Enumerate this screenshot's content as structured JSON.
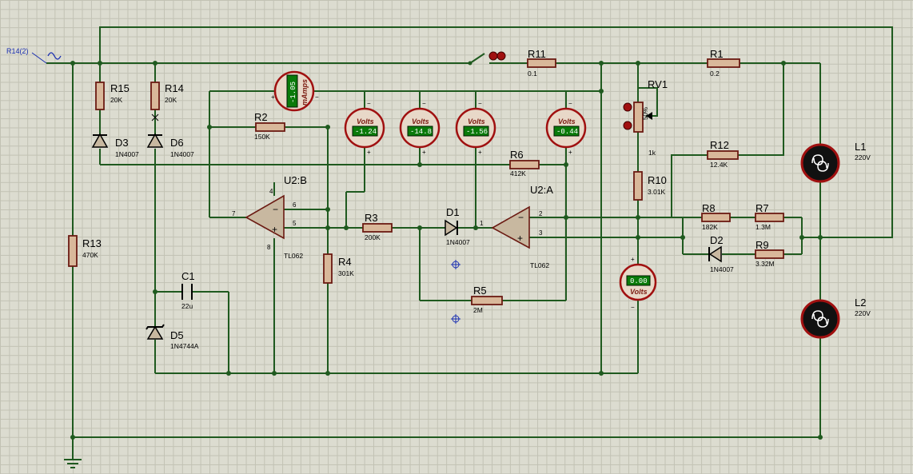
{
  "source_label": "R14(2)",
  "components": {
    "R15": {
      "name": "R15",
      "value": "20K"
    },
    "R14": {
      "name": "R14",
      "value": "20K"
    },
    "D3": {
      "name": "D3",
      "value": "1N4007"
    },
    "D6": {
      "name": "D6",
      "value": "1N4007"
    },
    "R13": {
      "name": "R13",
      "value": "470K"
    },
    "C1": {
      "name": "C1",
      "value": "22u"
    },
    "D5": {
      "name": "D5",
      "value": "1N4744A"
    },
    "R2": {
      "name": "R2",
      "value": "150K"
    },
    "U2B": {
      "name": "U2:B",
      "value": "TL062"
    },
    "R4": {
      "name": "R4",
      "value": "301K"
    },
    "R3": {
      "name": "R3",
      "value": "200K"
    },
    "D1": {
      "name": "D1",
      "value": "1N4007"
    },
    "R5": {
      "name": "R5",
      "value": "2M"
    },
    "U2A": {
      "name": "U2:A",
      "value": "TL062"
    },
    "R6": {
      "name": "R6",
      "value": "412K"
    },
    "R11": {
      "name": "R11",
      "value": "0.1"
    },
    "R1": {
      "name": "R1",
      "value": "0.2"
    },
    "RV1": {
      "name": "RV1",
      "value": "1k",
      "percent": "50%"
    },
    "R10": {
      "name": "R10",
      "value": "3.01K"
    },
    "R12": {
      "name": "R12",
      "value": "12.4K"
    },
    "R8": {
      "name": "R8",
      "value": "182K"
    },
    "R7": {
      "name": "R7",
      "value": "1.3M"
    },
    "D2": {
      "name": "D2",
      "value": "1N4007"
    },
    "R9": {
      "name": "R9",
      "value": "3.32M"
    },
    "L1": {
      "name": "L1",
      "value": "220V"
    },
    "L2": {
      "name": "L2",
      "value": "220V"
    }
  },
  "meters": {
    "ammeter": {
      "reading": "-1.05",
      "unit": "mAmps"
    },
    "v1": {
      "reading": "-1.24",
      "unit": "Volts"
    },
    "v2": {
      "reading": "-14.8",
      "unit": "Volts"
    },
    "v3": {
      "reading": "-1.56",
      "unit": "Volts"
    },
    "v4": {
      "reading": "-0.44",
      "unit": "Volts"
    },
    "v5": {
      "reading": "0.00",
      "unit": "Volts"
    }
  },
  "pins": {
    "u2b_pin6": "6",
    "u2b_pin5": "5",
    "u2b_pin7": "7",
    "u2b_pin4": "4",
    "u2b_pin8": "8",
    "u2a_pin1": "1",
    "u2a_pin2": "2",
    "u2a_pin3": "3",
    "plus": "+",
    "minus": "−"
  },
  "colors": {
    "wire": "#1f5a1f",
    "component": "#6b1a12",
    "lcd": "#0a7a0a",
    "grid": "#c2c2b4"
  }
}
